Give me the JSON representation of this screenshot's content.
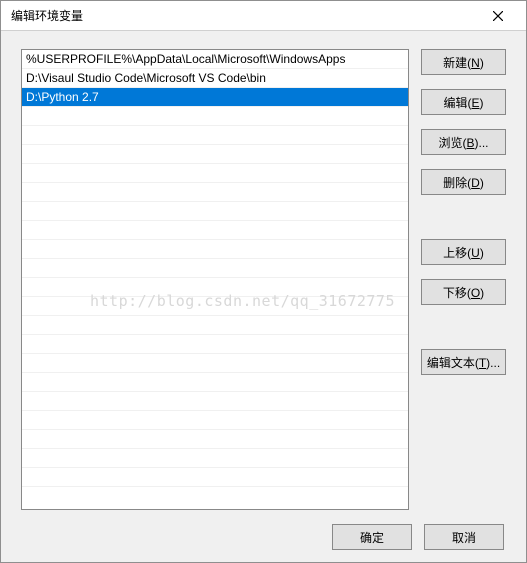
{
  "window": {
    "title": "编辑环境变量"
  },
  "list": {
    "items": [
      "%USERPROFILE%\\AppData\\Local\\Microsoft\\WindowsApps",
      "D:\\Visaul Studio Code\\Microsoft VS Code\\bin",
      "D:\\Python 2.7"
    ],
    "selected_index": 2
  },
  "buttons": {
    "new": {
      "label": "新建(",
      "key": "N",
      "suffix": ")"
    },
    "edit": {
      "label": "编辑(",
      "key": "E",
      "suffix": ")"
    },
    "browse": {
      "label": "浏览(",
      "key": "B",
      "suffix": ")..."
    },
    "delete": {
      "label": "删除(",
      "key": "D",
      "suffix": ")"
    },
    "moveup": {
      "label": "上移(",
      "key": "U",
      "suffix": ")"
    },
    "movedown": {
      "label": "下移(",
      "key": "O",
      "suffix": ")"
    },
    "edittext": {
      "label": "编辑文本(",
      "key": "T",
      "suffix": ")..."
    },
    "ok": "确定",
    "cancel": "取消"
  },
  "watermark": "http://blog.csdn.net/qq_31672775"
}
